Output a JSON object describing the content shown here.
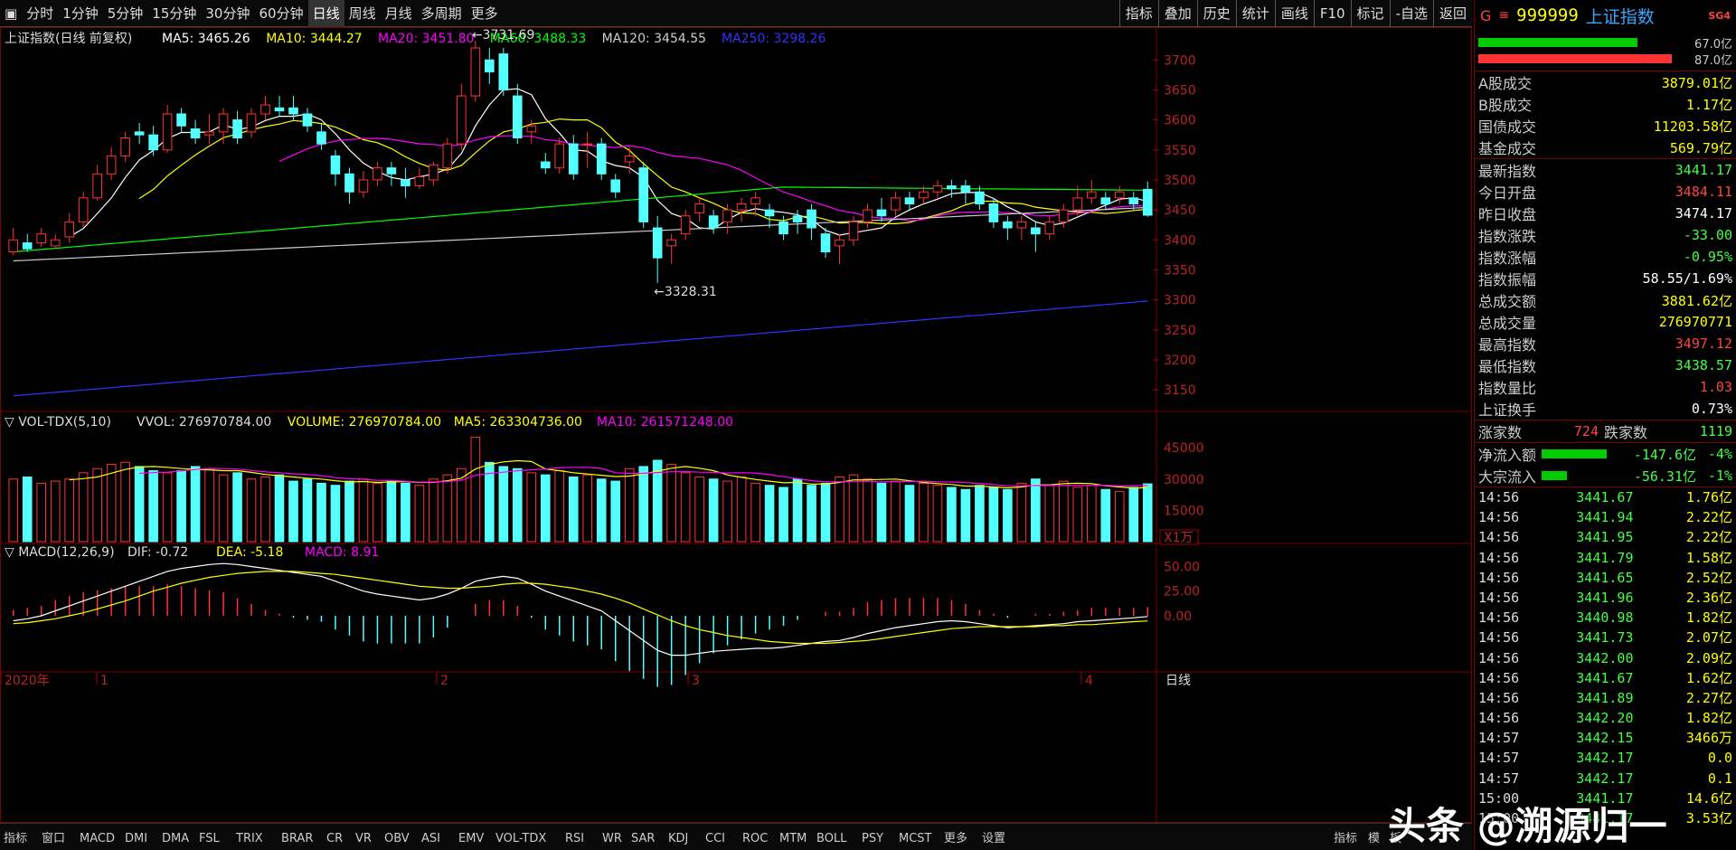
{
  "toolbar": {
    "tabs": [
      "分时",
      "1分钟",
      "5分钟",
      "15分钟",
      "30分钟",
      "60分钟",
      "日线",
      "周线",
      "月线",
      "多周期",
      "更多"
    ],
    "active_tab": "日线",
    "right_buttons": [
      "指标",
      "叠加",
      "历史",
      "统计",
      "画线",
      "F10",
      "标记",
      "-自选",
      "返回"
    ]
  },
  "main": {
    "title": "上证指数(日线 前复权)",
    "ma_labels": [
      {
        "text": "MA5: 3465.26",
        "color": "#ffffff"
      },
      {
        "text": "MA10: 3444.27",
        "color": "#ffff00"
      },
      {
        "text": "MA20: 3451.80",
        "color": "#ff00ff"
      },
      {
        "text": "MA60: 3488.33",
        "color": "#00ff00"
      },
      {
        "text": "MA120: 3454.55",
        "color": "#cccccc"
      },
      {
        "text": "MA250: 3298.26",
        "color": "#3333ff"
      }
    ],
    "high_mark": "3731.69",
    "low_mark": "3328.31",
    "yticks": [
      "3700",
      "3650",
      "3600",
      "3550",
      "3500",
      "3450",
      "3400",
      "3350",
      "3300",
      "3250",
      "3200",
      "3150"
    ]
  },
  "vol": {
    "title": "VOL-TDX(5,10)",
    "labels": [
      {
        "text": "VVOL: 276970784.00",
        "color": "#dddddd"
      },
      {
        "text": "VOLUME: 276970784.00",
        "color": "#ffff00"
      },
      {
        "text": "MA5: 263304736.00",
        "color": "#ffff00"
      },
      {
        "text": "MA10: 261571248.00",
        "color": "#ff00ff"
      }
    ],
    "yticks": [
      "45000",
      "30000",
      "15000"
    ],
    "unit": "X1万"
  },
  "macd": {
    "title": "MACD(12,26,9)",
    "labels": [
      {
        "text": "DIF: -0.72",
        "color": "#dddddd"
      },
      {
        "text": "DEA: -5.18",
        "color": "#ffff00"
      },
      {
        "text": "MACD: 8.91",
        "color": "#ff00ff"
      }
    ],
    "yticks": [
      "50.00",
      "25.00",
      "0.00"
    ]
  },
  "xaxis": {
    "labels": [
      "2020年",
      "1",
      "2",
      "3",
      "4"
    ],
    "right_label": "日线"
  },
  "chart_data": {
    "type": "candlestick",
    "x_labels": [
      "2020年",
      "1",
      "2",
      "3",
      "4"
    ],
    "y_range": [
      3120,
      3720
    ],
    "candles": [
      [
        3380,
        3400,
        3420,
        3375
      ],
      [
        3395,
        3385,
        3410,
        3380
      ],
      [
        3395,
        3410,
        3420,
        3388
      ],
      [
        3390,
        3400,
        3410,
        3385
      ],
      [
        3405,
        3430,
        3445,
        3395
      ],
      [
        3430,
        3470,
        3480,
        3420
      ],
      [
        3470,
        3510,
        3525,
        3465
      ],
      [
        3510,
        3540,
        3555,
        3500
      ],
      [
        3540,
        3570,
        3580,
        3530
      ],
      [
        3580,
        3575,
        3595,
        3560
      ],
      [
        3575,
        3550,
        3590,
        3540
      ],
      [
        3550,
        3610,
        3625,
        3545
      ],
      [
        3610,
        3590,
        3620,
        3580
      ],
      [
        3585,
        3570,
        3600,
        3560
      ],
      [
        3575,
        3580,
        3610,
        3560
      ],
      [
        3580,
        3610,
        3620,
        3560
      ],
      [
        3600,
        3570,
        3615,
        3560
      ],
      [
        3580,
        3610,
        3620,
        3570
      ],
      [
        3610,
        3625,
        3640,
        3600
      ],
      [
        3620,
        3615,
        3640,
        3605
      ],
      [
        3620,
        3610,
        3640,
        3600
      ],
      [
        3610,
        3590,
        3620,
        3580
      ],
      [
        3580,
        3560,
        3595,
        3550
      ],
      [
        3540,
        3510,
        3550,
        3490
      ],
      [
        3510,
        3480,
        3520,
        3460
      ],
      [
        3480,
        3500,
        3515,
        3470
      ],
      [
        3500,
        3520,
        3530,
        3490
      ],
      [
        3520,
        3510,
        3530,
        3490
      ],
      [
        3500,
        3490,
        3520,
        3470
      ],
      [
        3490,
        3505,
        3520,
        3485
      ],
      [
        3500,
        3525,
        3530,
        3490
      ],
      [
        3520,
        3560,
        3570,
        3510
      ],
      [
        3560,
        3640,
        3660,
        3550
      ],
      [
        3640,
        3720,
        3731.69,
        3630
      ],
      [
        3700,
        3680,
        3720,
        3660
      ],
      [
        3710,
        3650,
        3720,
        3640
      ],
      [
        3640,
        3570,
        3660,
        3560
      ],
      [
        3580,
        3590,
        3600,
        3560
      ],
      [
        3530,
        3520,
        3545,
        3510
      ],
      [
        3520,
        3560,
        3570,
        3510
      ],
      [
        3560,
        3510,
        3575,
        3500
      ],
      [
        3560,
        3560,
        3580,
        3520
      ],
      [
        3560,
        3510,
        3570,
        3500
      ],
      [
        3500,
        3480,
        3510,
        3470
      ],
      [
        3530,
        3540,
        3555,
        3510
      ],
      [
        3520,
        3430,
        3530,
        3420
      ],
      [
        3420,
        3370,
        3440,
        3328.31
      ],
      [
        3390,
        3400,
        3410,
        3360
      ],
      [
        3410,
        3440,
        3450,
        3400
      ],
      [
        3445,
        3460,
        3470,
        3430
      ],
      [
        3440,
        3420,
        3450,
        3410
      ],
      [
        3430,
        3450,
        3460,
        3410
      ],
      [
        3450,
        3460,
        3470,
        3430
      ],
      [
        3460,
        3470,
        3480,
        3440
      ],
      [
        3450,
        3440,
        3460,
        3420
      ],
      [
        3430,
        3410,
        3440,
        3400
      ],
      [
        3440,
        3430,
        3450,
        3410
      ],
      [
        3450,
        3420,
        3460,
        3400
      ],
      [
        3410,
        3380,
        3420,
        3370
      ],
      [
        3390,
        3400,
        3410,
        3360
      ],
      [
        3400,
        3430,
        3440,
        3390
      ],
      [
        3430,
        3450,
        3460,
        3420
      ],
      [
        3450,
        3440,
        3470,
        3430
      ],
      [
        3450,
        3470,
        3480,
        3440
      ],
      [
        3470,
        3460,
        3480,
        3450
      ],
      [
        3470,
        3480,
        3490,
        3460
      ],
      [
        3480,
        3490,
        3500,
        3470
      ],
      [
        3490,
        3485,
        3500,
        3470
      ],
      [
        3490,
        3480,
        3500,
        3460
      ],
      [
        3480,
        3460,
        3490,
        3450
      ],
      [
        3460,
        3430,
        3470,
        3420
      ],
      [
        3430,
        3420,
        3440,
        3400
      ],
      [
        3420,
        3430,
        3440,
        3400
      ],
      [
        3420,
        3410,
        3430,
        3380
      ],
      [
        3410,
        3430,
        3440,
        3400
      ],
      [
        3430,
        3450,
        3460,
        3420
      ],
      [
        3450,
        3470,
        3490,
        3440
      ],
      [
        3470,
        3480,
        3500,
        3460
      ],
      [
        3470,
        3460,
        3480,
        3450
      ],
      [
        3470,
        3480,
        3490,
        3460
      ],
      [
        3470,
        3460,
        3480,
        3450
      ],
      [
        3484.11,
        3441.17,
        3497.12,
        3438.57
      ]
    ],
    "volume": [
      30,
      31,
      28,
      29,
      30,
      33,
      35,
      37,
      38,
      36,
      34,
      33,
      34,
      36,
      35,
      32,
      33,
      30,
      31,
      32,
      29,
      30,
      28,
      27,
      29,
      30,
      28,
      29,
      28,
      27,
      30,
      32,
      35,
      50,
      38,
      36,
      35,
      33,
      32,
      34,
      31,
      32,
      30,
      29,
      35,
      36,
      39,
      37,
      33,
      31,
      30,
      29,
      31,
      28,
      27,
      26,
      30,
      27,
      28,
      31,
      32,
      30,
      28,
      29,
      27,
      28,
      27,
      26,
      25,
      27,
      26,
      25,
      28,
      30,
      27,
      29,
      26,
      27,
      25,
      24,
      26,
      27.7
    ],
    "macd_dif": [
      -5,
      -3,
      0,
      5,
      10,
      15,
      20,
      25,
      30,
      35,
      40,
      45,
      48,
      50,
      52,
      53,
      52,
      50,
      48,
      46,
      44,
      42,
      40,
      35,
      30,
      25,
      22,
      20,
      18,
      16,
      18,
      22,
      28,
      35,
      38,
      40,
      38,
      32,
      25,
      20,
      15,
      10,
      5,
      -5,
      -15,
      -25,
      -35,
      -40,
      -40,
      -38,
      -36,
      -35,
      -34,
      -33,
      -33,
      -32,
      -30,
      -28,
      -26,
      -25,
      -22,
      -18,
      -15,
      -12,
      -10,
      -8,
      -6,
      -5,
      -6,
      -8,
      -10,
      -12,
      -11,
      -10,
      -9,
      -8,
      -6,
      -5,
      -4,
      -3,
      -2,
      -0.72
    ],
    "macd_dea": [
      -8,
      -7,
      -5,
      -3,
      0,
      3,
      7,
      11,
      15,
      20,
      25,
      29,
      33,
      36,
      39,
      41,
      43,
      44,
      45,
      45,
      45,
      44,
      43,
      42,
      40,
      38,
      36,
      34,
      32,
      30,
      29,
      28,
      28,
      29,
      30,
      32,
      33,
      33,
      32,
      30,
      28,
      25,
      22,
      18,
      13,
      7,
      1,
      -5,
      -10,
      -14,
      -17,
      -20,
      -22,
      -24,
      -26,
      -27,
      -28,
      -28,
      -28,
      -27,
      -26,
      -25,
      -23,
      -21,
      -19,
      -17,
      -15,
      -13,
      -12,
      -11,
      -11,
      -11,
      -11,
      -11,
      -10,
      -10,
      -9,
      -9,
      -8,
      -7,
      -6,
      -5.18
    ]
  },
  "right_panel": {
    "code": "999999",
    "name": "上证指数",
    "badge": "SG4",
    "g_label": "G",
    "bar_pcts": [
      "67.0亿",
      "87.0亿"
    ],
    "bar_fill": [
      0.78,
      0.95
    ],
    "stats1": [
      {
        "label": "A股成交",
        "value": "3879.01亿",
        "color": "#ffff00"
      },
      {
        "label": "B股成交",
        "value": "1.17亿",
        "color": "#ffff00"
      },
      {
        "label": "国债成交",
        "value": "11203.58亿",
        "color": "#ffff00"
      },
      {
        "label": "基金成交",
        "value": "569.79亿",
        "color": "#ffff00"
      }
    ],
    "stats2": [
      {
        "label": "最新指数",
        "value": "3441.17",
        "color": "#44ff44"
      },
      {
        "label": "今日开盘",
        "value": "3484.11",
        "color": "#ff4444"
      },
      {
        "label": "昨日收盘",
        "value": "3474.17",
        "color": "#ffffff"
      },
      {
        "label": "指数涨跌",
        "value": "-33.00",
        "color": "#44ff44"
      },
      {
        "label": "指数涨幅",
        "value": "-0.95%",
        "color": "#44ff44"
      },
      {
        "label": "指数振幅",
        "value": "58.55/1.69%",
        "color": "#ffffff"
      },
      {
        "label": "总成交额",
        "value": "3881.62亿",
        "color": "#ffff00"
      },
      {
        "label": "总成交量",
        "value": "276970771",
        "color": "#ffff00"
      },
      {
        "label": "最高指数",
        "value": "3497.12",
        "color": "#ff4444"
      },
      {
        "label": "最低指数",
        "value": "3438.57",
        "color": "#44ff44"
      },
      {
        "label": "指数量比",
        "value": "1.03",
        "color": "#ff4444"
      },
      {
        "label": "上证换手",
        "value": "0.73%",
        "color": "#ffffff"
      }
    ],
    "updown": {
      "up_label": "涨家数",
      "up": "724",
      "down_label": "跌家数",
      "down": "1119"
    },
    "flows": [
      {
        "label": "净流入额",
        "value": "-147.6亿",
        "pct": "-4%",
        "fill": 0.9
      },
      {
        "label": "大宗流入",
        "value": "-56.31亿",
        "pct": "-1%",
        "fill": 0.35
      }
    ],
    "ticks": [
      [
        "14:56",
        "3441.67",
        "1.76亿"
      ],
      [
        "14:56",
        "3441.94",
        "2.22亿"
      ],
      [
        "14:56",
        "3441.95",
        "2.22亿"
      ],
      [
        "14:56",
        "3441.79",
        "1.58亿"
      ],
      [
        "14:56",
        "3441.65",
        "2.52亿"
      ],
      [
        "14:56",
        "3441.96",
        "2.36亿"
      ],
      [
        "14:56",
        "3440.98",
        "1.82亿"
      ],
      [
        "14:56",
        "3441.73",
        "2.07亿"
      ],
      [
        "14:56",
        "3442.00",
        "2.09亿"
      ],
      [
        "14:56",
        "3441.67",
        "1.62亿"
      ],
      [
        "14:56",
        "3441.89",
        "2.27亿"
      ],
      [
        "14:56",
        "3442.20",
        "1.82亿"
      ],
      [
        "14:57",
        "3442.15",
        "3466万"
      ],
      [
        "14:57",
        "3442.17",
        "0.0"
      ],
      [
        "14:57",
        "3442.17",
        "0.1"
      ],
      [
        "15:00",
        "3441.17",
        "14.6亿"
      ],
      [
        "15:00",
        "3441.17",
        "3.53亿"
      ]
    ]
  },
  "bottom": {
    "items": [
      "指标",
      "窗口",
      "MACD",
      "DMI",
      "DMA",
      "FSL",
      "TRIX",
      "BRAR",
      "CR",
      "VR",
      "OBV",
      "ASI",
      "EMV",
      "VOL-TDX",
      "RSI",
      "WR",
      "SAR",
      "KDJ",
      "CCI",
      "ROC",
      "MTM",
      "BOLL",
      "PSY",
      "MCST",
      "更多",
      "设置"
    ],
    "right_items": [
      "指标",
      "模",
      "板"
    ]
  },
  "watermark": "头条 @溯源归一"
}
